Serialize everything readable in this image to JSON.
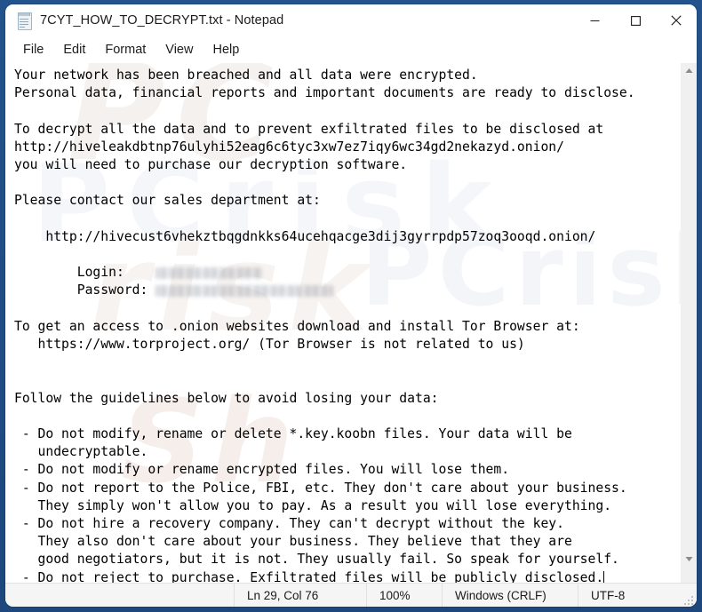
{
  "window": {
    "title": "7CYT_HOW_TO_DECRYPT.txt - Notepad",
    "icon": "notepad-icon",
    "controls": {
      "minimize": "minimize-icon",
      "maximize": "maximize-icon",
      "close": "close-icon"
    }
  },
  "menu": {
    "items": [
      {
        "label": "File"
      },
      {
        "label": "Edit"
      },
      {
        "label": "Format"
      },
      {
        "label": "View"
      },
      {
        "label": "Help"
      }
    ]
  },
  "document": {
    "lines": [
      "Your network has been breached and all data were encrypted.",
      "Personal data, financial reports and important documents are ready to disclose.",
      "",
      "To decrypt all the data and to prevent exfiltrated files to be disclosed at",
      "http://hiveleakdbtnp76ulyhi52eag6c6tyc3xw7ez7iqy6wc34gd2nekazyd.onion/",
      "you will need to purchase our decryption software.",
      "",
      "Please contact our sales department at:",
      "",
      "    http://hivecust6vhekztbqgdnkks64ucehqacge3dij3gyrrpdp57zoq3ooqd.onion/",
      "",
      "        Login:    [REDACTED]",
      "        Password: [REDACTED]",
      "",
      "To get an access to .onion websites download and install Tor Browser at:",
      "   https://www.torproject.org/ (Tor Browser is not related to us)",
      "",
      "",
      "Follow the guidelines below to avoid losing your data:",
      "",
      " - Do not modify, rename or delete *.key.koobn files. Your data will be",
      "   undecryptable.",
      " - Do not modify or rename encrypted files. You will lose them.",
      " - Do not report to the Police, FBI, etc. They don't care about your business.",
      "   They simply won't allow you to pay. As a result you will lose everything.",
      " - Do not hire a recovery company. They can't decrypt without the key.",
      "   They also don't care about your business. They believe that they are",
      "   good negotiators, but it is not. They usually fail. So speak for yourself.",
      " - Do not reject to purchase. Exfiltrated files will be publicly disclosed."
    ],
    "segments": {
      "part1": "Your network has been breached and all data were encrypted.\nPersonal data, financial reports and important documents are ready to disclose.\n\nTo decrypt all the data and to prevent exfiltrated files to be disclosed at\nhttp://hiveleakdbtnp76ulyhi52eag6c6tyc3xw7ez7iqy6wc34gd2nekazyd.onion/\nyou will need to purchase our decryption software.\n\nPlease contact our sales department at:\n\n    http://hivecust6vhekztbqgdnkks64ucehqacge3dij3gyrrpdp57zoq3ooqd.onion/\n\n        Login:    ",
      "part2": "\n        Password: ",
      "part3": "\n\nTo get an access to .onion websites download and install Tor Browser at:\n   https://www.torproject.org/ (Tor Browser is not related to us)\n\n\nFollow the guidelines below to avoid losing your data:\n\n - Do not modify, rename or delete *.key.koobn files. Your data will be\n   undecryptable.\n - Do not modify or rename encrypted files. You will lose them.\n - Do not report to the Police, FBI, etc. They don't care about your business.\n   They simply won't allow you to pay. As a result you will lose everything.\n - Do not hire a recovery company. They can't decrypt without the key.\n   They also don't care about your business. They believe that they are\n   good negotiators, but it is not. They usually fail. So speak for yourself.\n - Do not reject to purchase. Exfiltrated files will be publicly disclosed."
    },
    "redacted_login_note": "blurred",
    "redacted_password_note": "blurred"
  },
  "watermark": {
    "text_a": "PC",
    "text_b": "risk",
    "text_c": "Sh",
    "text_d": "PCrisk",
    "text_e": "PCrisk"
  },
  "scrollbar": {
    "up_arrow": "scroll-up-arrow-icon",
    "down_arrow": "scroll-down-arrow-icon"
  },
  "statusbar": {
    "line_col": "Ln 29, Col 76",
    "zoom": "100%",
    "line_ending": "Windows (CRLF)",
    "encoding": "UTF-8",
    "resize_grip": "resize-grip-icon"
  },
  "colors": {
    "frame_blue": "#23528c",
    "window_bg": "#ffffff",
    "statusbar_bg": "#f5f5f5",
    "text": "#000000",
    "scrollbar_track": "#f0f0f0"
  }
}
